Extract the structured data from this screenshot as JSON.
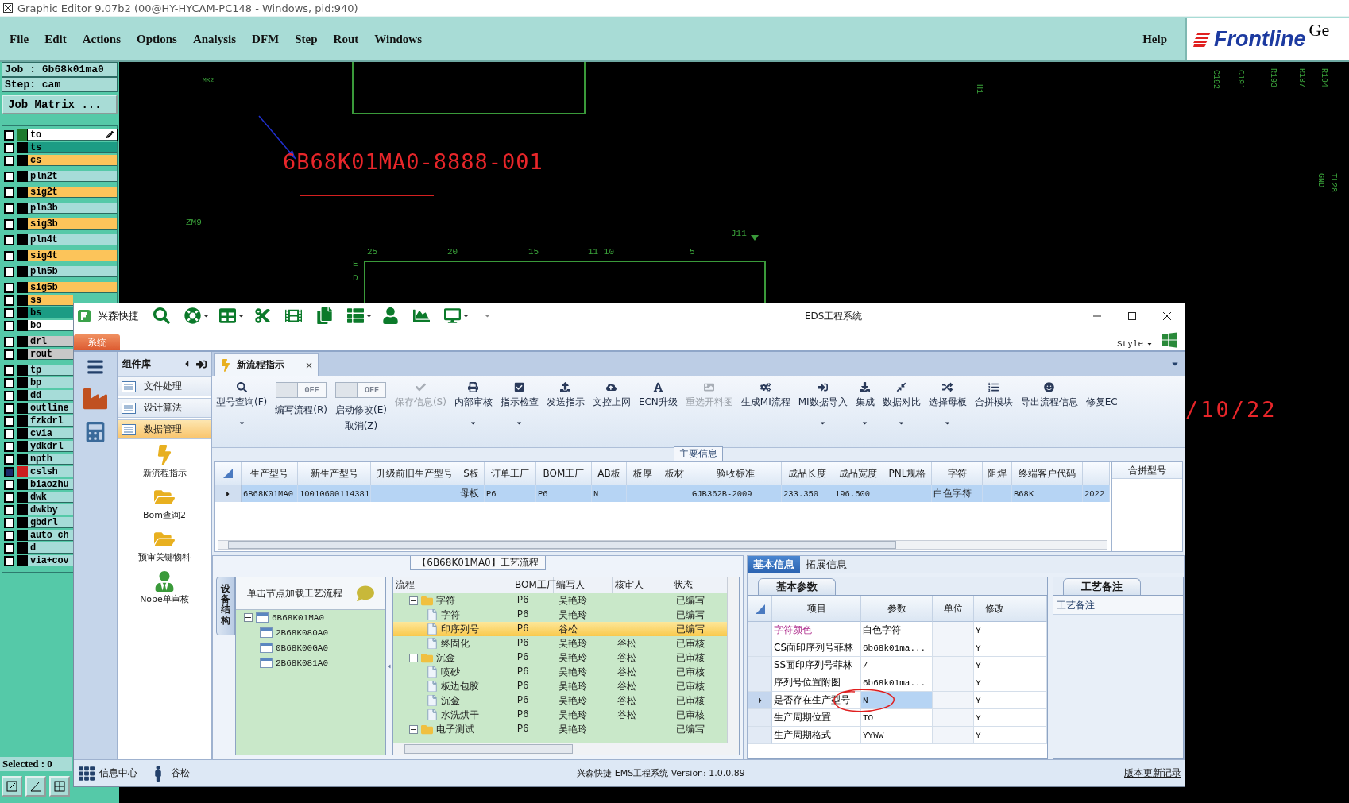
{
  "cam": {
    "title": "Graphic Editor 9.07b2 (00@HY-HYCAM-PC148 - Windows, pid:940)",
    "menu": [
      "File",
      "Edit",
      "Actions",
      "Options",
      "Analysis",
      "DFM",
      "Step",
      "Rout",
      "Windows"
    ],
    "help": "Help",
    "logo": "Frontline",
    "logo_tail": "Ge",
    "job": "Job : 6b68k01ma0",
    "step": "Step: cam",
    "job_matrix": "Job Matrix ...",
    "layer_groups": [
      {
        "layers": [
          {
            "name": "to",
            "color": "#ffffff",
            "swatch": {
              "color": "#1e7a2e"
            },
            "selected": false,
            "editing": true
          },
          {
            "name": "ts",
            "color": "#1c9c84",
            "swatch": {
              "color": "#000000"
            },
            "selected": false,
            "editing": false
          },
          {
            "name": "cs",
            "color": "#fcc45a",
            "swatch": {
              "color": "#000000"
            },
            "selected": false,
            "editing": false
          }
        ]
      },
      {
        "layers": [
          {
            "name": "pln2t",
            "color": "#a6dcd8",
            "swatch": {
              "color": "#000000"
            },
            "selected": false,
            "editing": false
          }
        ]
      },
      {
        "layers": [
          {
            "name": "sig2t",
            "color": "#fcc45a",
            "swatch": {
              "color": "#000000"
            },
            "selected": false,
            "editing": false
          }
        ]
      },
      {
        "layers": [
          {
            "name": "pln3b",
            "color": "#a6dcd8",
            "swatch": {
              "color": "#000000"
            },
            "selected": false,
            "editing": false
          }
        ]
      },
      {
        "layers": [
          {
            "name": "sig3b",
            "color": "#fcc45a",
            "swatch": {
              "color": "#000000"
            },
            "selected": false,
            "editing": false
          }
        ]
      },
      {
        "layers": [
          {
            "name": "pln4t",
            "color": "#a6dcd8",
            "swatch": {
              "color": "#000000"
            },
            "selected": false,
            "editing": false
          }
        ]
      },
      {
        "layers": [
          {
            "name": "sig4t",
            "color": "#fcc45a",
            "swatch": {
              "color": "#000000"
            },
            "selected": false,
            "editing": false
          }
        ]
      },
      {
        "layers": [
          {
            "name": "pln5b",
            "color": "#a6dcd8",
            "swatch": {
              "color": "#000000"
            },
            "selected": false,
            "editing": false
          }
        ]
      },
      {
        "layers": [
          {
            "name": "sig5b",
            "color": "#fcc45a",
            "swatch": {
              "color": "#000000"
            },
            "selected": false,
            "editing": false
          },
          {
            "name": "ss",
            "color": "#fcc45a",
            "swatch": {
              "color": "#000000"
            },
            "selected": false,
            "editing": false
          },
          {
            "name": "bs",
            "color": "#1c9c84",
            "swatch": {
              "color": "#000000"
            },
            "selected": false,
            "editing": false
          },
          {
            "name": "bo",
            "color": "#ffffff",
            "swatch": {
              "color": "#000000"
            },
            "selected": false,
            "editing": false
          }
        ]
      },
      {
        "layers": [
          {
            "name": "drl",
            "color": "#c8c8c8",
            "swatch": {
              "color": "#000000"
            },
            "selected": false,
            "editing": false
          },
          {
            "name": "rout",
            "color": "#c8c8c8",
            "swatch": {
              "color": "#000000"
            },
            "selected": false,
            "editing": false
          }
        ]
      },
      {
        "layers": [
          {
            "name": "tp",
            "color": "#a6dcd8",
            "swatch": {
              "color": "#000000"
            },
            "selected": false,
            "editing": false
          },
          {
            "name": "bp",
            "color": "#a6dcd8",
            "swatch": {
              "color": "#000000"
            },
            "selected": false,
            "editing": false
          },
          {
            "name": "dd",
            "color": "#a6dcd8",
            "swatch": {
              "color": "#000000"
            },
            "selected": false,
            "editing": false
          },
          {
            "name": "outline",
            "color": "#a6dcd8",
            "swatch": {
              "color": "#000000"
            },
            "selected": false,
            "editing": false
          },
          {
            "name": "fzkdrl",
            "color": "#a6dcd8",
            "swatch": {
              "color": "#000000"
            },
            "selected": false,
            "editing": false
          },
          {
            "name": "cvia",
            "color": "#a6dcd8",
            "swatch": {
              "color": "#000000"
            },
            "selected": false,
            "editing": false
          },
          {
            "name": "ydkdrl",
            "color": "#a6dcd8",
            "swatch": {
              "color": "#000000"
            },
            "selected": false,
            "editing": false
          },
          {
            "name": "npth",
            "color": "#a6dcd8",
            "swatch": {
              "color": "#000000"
            },
            "selected": false,
            "editing": false
          },
          {
            "name": "cslsh",
            "color": "#a6dcd8",
            "swatch": {
              "color": "#cc1f1f"
            },
            "selected": true,
            "editing": false
          },
          {
            "name": "biaozhu",
            "color": "#a6dcd8",
            "swatch": {
              "color": "#000000"
            },
            "selected": false,
            "editing": false
          },
          {
            "name": "dwk",
            "color": "#a6dcd8",
            "swatch": {
              "color": "#000000"
            },
            "selected": false,
            "editing": false
          },
          {
            "name": "dwkby",
            "color": "#a6dcd8",
            "swatch": {
              "color": "#000000"
            },
            "selected": false,
            "editing": false
          },
          {
            "name": "gbdrl",
            "color": "#a6dcd8",
            "swatch": {
              "color": "#000000"
            },
            "selected": false,
            "editing": false
          },
          {
            "name": "auto_ch",
            "color": "#a6dcd8",
            "swatch": {
              "color": "#000000"
            },
            "selected": false,
            "editing": false
          },
          {
            "name": "d",
            "color": "#a6dcd8",
            "swatch": {
              "color": "#000000"
            },
            "selected": false,
            "editing": false
          },
          {
            "name": "via+cov",
            "color": "#a6dcd8",
            "swatch": {
              "color": "#000000"
            },
            "selected": false,
            "editing": false
          }
        ]
      }
    ],
    "selected_count": "Selected : 0",
    "canvas": {
      "serial": "6B68K01MA0-8888-001",
      "date_fragment": "/10/22",
      "labels": [
        "MK2",
        "ZM9",
        "J11",
        "E",
        "D"
      ],
      "ruler": [
        "25",
        "20",
        "15",
        "11 10",
        "5"
      ],
      "vertical_labels": [
        "H1",
        "C192",
        "C191",
        "R193",
        "R187",
        "R194",
        "TL28",
        "GND"
      ]
    }
  },
  "eds": {
    "app_name": "兴森快捷",
    "title": "EDS工程系统",
    "system_tab": "系统",
    "style": "Style",
    "sidebar": {
      "title": "组件库",
      "categories": [
        {
          "label": "文件处理",
          "selected": false
        },
        {
          "label": "设计算法",
          "selected": false
        },
        {
          "label": "数据管理",
          "selected": true
        }
      ],
      "tools": [
        "新流程指示",
        "Bom查询2",
        "预审关键物料",
        "Nope单审核"
      ]
    },
    "doc_tab": {
      "label": "新流程指示",
      "close": "×"
    },
    "ribbon": [
      {
        "kind": "button",
        "label": "型号查询(F)",
        "disabled": false,
        "dropdown": true
      },
      {
        "kind": "toggle",
        "state": "OFF",
        "on": false,
        "label": "编写流程(R)"
      },
      {
        "kind": "toggle",
        "state": "OFF",
        "on": false,
        "label": "启动修改(E)",
        "sublabel": "取消(Z)"
      },
      {
        "kind": "button",
        "label": "保存信息(S)",
        "disabled": true,
        "dropdown": false
      },
      {
        "kind": "button",
        "label": "内部审核",
        "disabled": false,
        "dropdown": true
      },
      {
        "kind": "button",
        "label": "指示检查",
        "disabled": false,
        "dropdown": true
      },
      {
        "kind": "button",
        "label": "发送指示",
        "disabled": false,
        "dropdown": false
      },
      {
        "kind": "button",
        "label": "文控上网",
        "disabled": false,
        "dropdown": false
      },
      {
        "kind": "button",
        "label": "ECN升级",
        "disabled": false,
        "dropdown": false
      },
      {
        "kind": "button",
        "label": "重选开料图",
        "disabled": true,
        "dropdown": false
      },
      {
        "kind": "button",
        "label": "生成MI流程",
        "disabled": false,
        "dropdown": false
      },
      {
        "kind": "button",
        "label": "MI数据导入",
        "disabled": false,
        "dropdown": true
      },
      {
        "kind": "button",
        "label": "集成",
        "disabled": false,
        "dropdown": true
      },
      {
        "kind": "button",
        "label": "数据对比",
        "disabled": false,
        "dropdown": true
      },
      {
        "kind": "button",
        "label": "选择母板",
        "disabled": false,
        "dropdown": true
      },
      {
        "kind": "button",
        "label": "合拼模块",
        "disabled": false,
        "dropdown": false
      },
      {
        "kind": "button",
        "label": "导出流程信息",
        "disabled": false,
        "dropdown": false
      },
      {
        "kind": "button",
        "label": "修复EC",
        "disabled": false,
        "dropdown": false
      }
    ],
    "main_group": "主要信息",
    "table": {
      "columns": [
        "生产型号",
        "新生产型号",
        "升级前旧生产型号",
        "S板",
        "订单工厂",
        "BOM工厂",
        "AB板",
        "板厚",
        "板材",
        "验收标准",
        "成品长度",
        "成品宽度",
        "PNL规格",
        "字符",
        "阻焊",
        "终端客户代码",
        null
      ],
      "rows": [
        {
          "current": true,
          "cells": [
            "6B68K01MA0",
            "10010600114381",
            null,
            "母板",
            "P6",
            "P6",
            "N",
            null,
            null,
            "GJB362B-2009",
            "233.350",
            "196.500",
            null,
            "白色字符",
            null,
            "B68K",
            "2022"
          ]
        }
      ],
      "side_column": "合拼型号"
    },
    "process": {
      "title": "【6B68K01MA0】工艺流程",
      "side_tab": "设备结构",
      "hint": "单击节点加载工艺流程",
      "tree": [
        {
          "label": "6B68K01MA0",
          "expanded": true,
          "children": [
            {
              "label": "2B68K080A0"
            },
            {
              "label": "0B68K00GA0"
            },
            {
              "label": "2B68K081A0"
            }
          ]
        }
      ],
      "columns": [
        "流程",
        "BOM工厂",
        "编写人",
        "核审人",
        "状态"
      ],
      "rows": [
        {
          "kind": "folder",
          "label": "字符",
          "expanded": true,
          "selected": false,
          "bom": "P6",
          "author": "吴艳玲",
          "status": "已编写",
          "children": [
            {
              "kind": "step",
              "label": "字符",
              "selected": false,
              "bom": "P6",
              "author": "吴艳玲",
              "status": "已编写"
            },
            {
              "kind": "step",
              "label": "印序列号",
              "selected": true,
              "bom": "P6",
              "author": "谷松",
              "status": "已编写"
            },
            {
              "kind": "step",
              "label": "终固化",
              "selected": false,
              "bom": "P6",
              "author": "吴艳玲",
              "reviewer": "谷松",
              "status": "已审核"
            }
          ]
        },
        {
          "kind": "folder",
          "label": "沉金",
          "expanded": true,
          "selected": false,
          "bom": "P6",
          "author": "吴艳玲",
          "reviewer": "谷松",
          "status": "已审核",
          "children": [
            {
              "kind": "step",
              "label": "喷砂",
              "selected": false,
              "bom": "P6",
              "author": "吴艳玲",
              "reviewer": "谷松",
              "status": "已审核"
            },
            {
              "kind": "step",
              "label": "板边包胶",
              "selected": false,
              "bom": "P6",
              "author": "吴艳玲",
              "reviewer": "谷松",
              "status": "已审核"
            },
            {
              "kind": "step",
              "label": "沉金",
              "selected": false,
              "bom": "P6",
              "author": "吴艳玲",
              "reviewer": "谷松",
              "status": "已审核"
            },
            {
              "kind": "step",
              "label": "水洗烘干",
              "selected": false,
              "bom": "P6",
              "author": "吴艳玲",
              "reviewer": "谷松",
              "status": "已审核"
            }
          ]
        },
        {
          "kind": "folder",
          "label": "电子测试",
          "expanded": true,
          "selected": false,
          "bom": "P6",
          "author": "吴艳玲",
          "status": "已编写"
        }
      ]
    },
    "info_tabs": [
      {
        "label": "基本信息",
        "selected": true
      },
      {
        "label": "拓展信息",
        "selected": false
      }
    ],
    "params_tab": "基本参数",
    "params_columns": [
      "项目",
      "参数",
      "单位",
      "修改"
    ],
    "params": [
      {
        "item": "字符颜色",
        "value": "白色字符",
        "modified": "Y",
        "color": "#b0308e",
        "current": false
      },
      {
        "item": "CS面印序列号菲林",
        "value": "6b68k01ma...",
        "modified": "Y",
        "current": false
      },
      {
        "item": "SS面印序列号菲林",
        "value": "/",
        "modified": "Y",
        "current": false
      },
      {
        "item": "序列号位置附图",
        "value": "6b68k01ma...",
        "modified": "Y",
        "current": false
      },
      {
        "item": "是否存在生产型号",
        "value": "N",
        "modified": "Y",
        "current": true
      },
      {
        "item": "生产周期位置",
        "value": "TO",
        "modified": "Y",
        "current": false
      },
      {
        "item": "生产周期格式",
        "value": "YYWW",
        "modified": "Y",
        "current": false
      }
    ],
    "notes_tab": "工艺备注",
    "notes_label": "工艺备注",
    "status": {
      "items": [
        "信息中心",
        "谷松"
      ],
      "version": "兴森快捷 EMS工程系统 Version: 1.0.0.89",
      "link": "版本更新记录"
    }
  }
}
